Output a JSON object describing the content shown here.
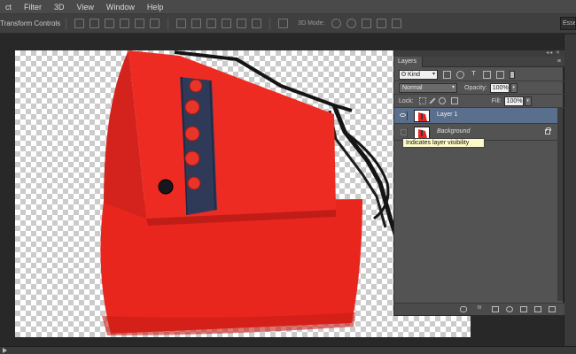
{
  "menu": {
    "items": [
      "ct",
      "Filter",
      "3D",
      "View",
      "Window",
      "Help"
    ]
  },
  "options_bar": {
    "transform_label": "Transform Controls",
    "mode_3d_label": "3D Mode:",
    "workspace_label": "Essentials"
  },
  "layers_panel": {
    "tab_label": "Layers",
    "filter_kind": "Kind",
    "blend_mode": "Normal",
    "opacity_label": "Opacity:",
    "opacity_value": "100%",
    "lock_label": "Lock:",
    "fill_label": "Fill:",
    "fill_value": "100%",
    "layers": [
      {
        "name": "Layer 1",
        "visible": true,
        "selected": true,
        "locked": false
      },
      {
        "name": "Background",
        "visible": false,
        "selected": false,
        "locked": true
      }
    ],
    "tooltip": "Indicates layer visibility",
    "bottom_icons": [
      "link-icon",
      "fx-icon",
      "mask-icon",
      "adjustment-icon",
      "folder-icon",
      "new-layer-icon",
      "trash-icon"
    ]
  },
  "colors": {
    "bag_red": "#e8261e",
    "panel_bg": "#535353",
    "selected_layer": "#5a6f8c",
    "tooltip_bg": "#fdf9c8"
  }
}
